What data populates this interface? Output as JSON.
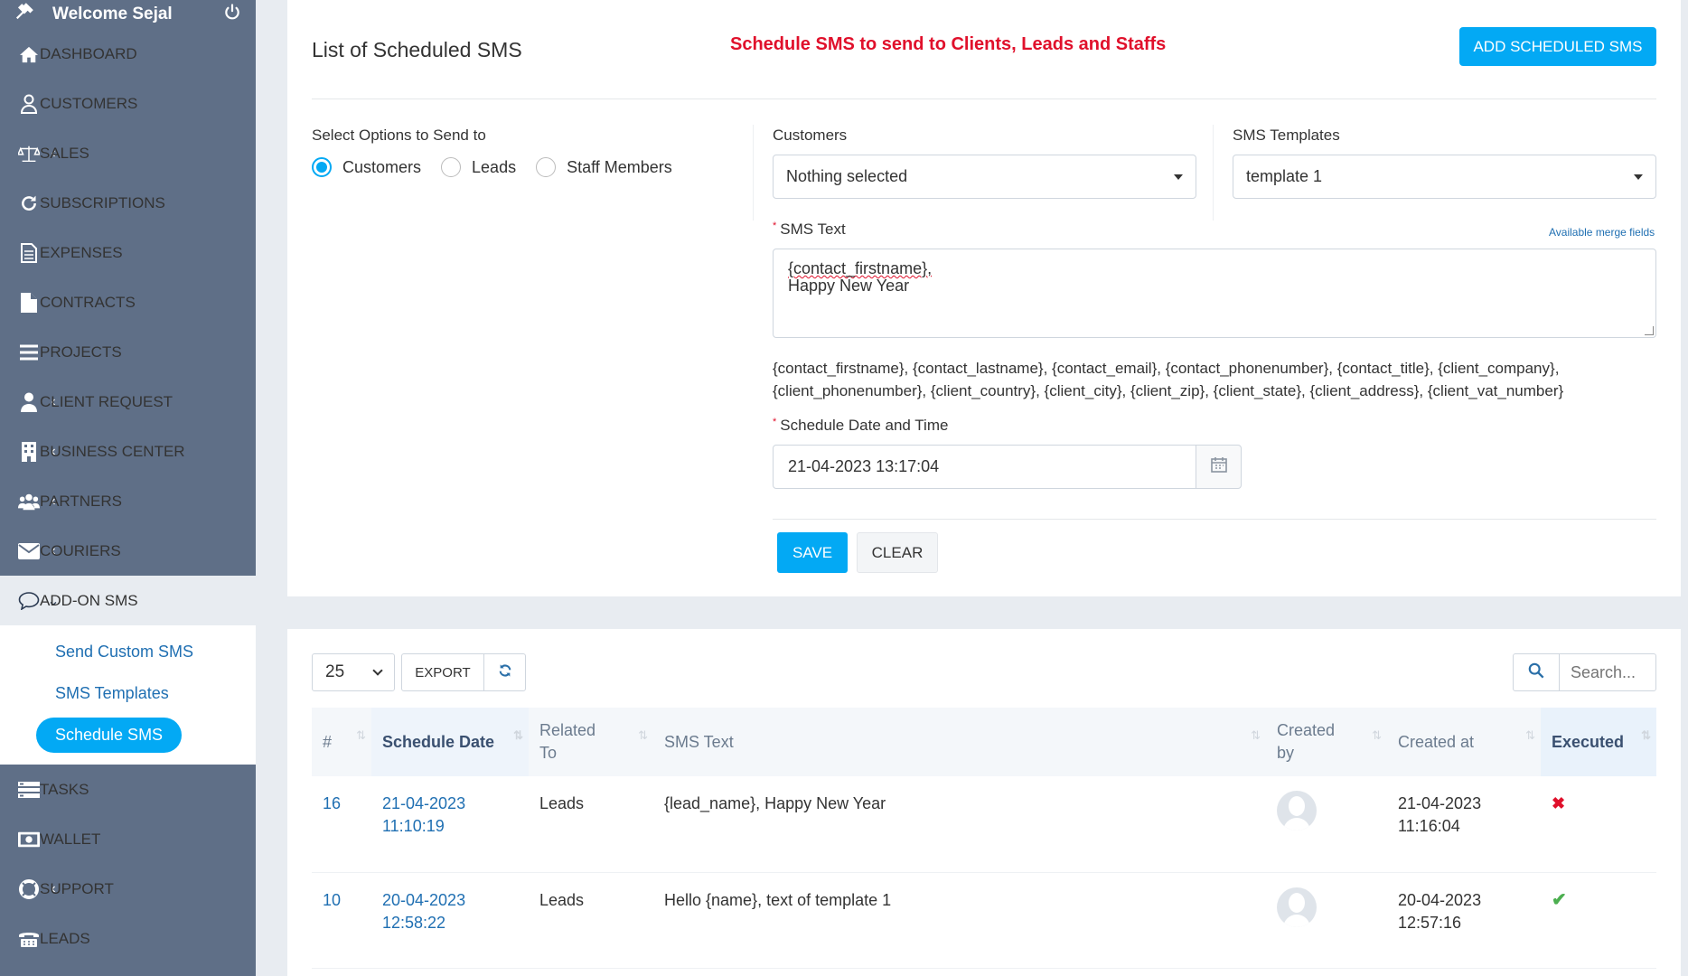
{
  "sidebar": {
    "welcome": "Welcome Sejal",
    "items": [
      {
        "label": "DASHBOARD",
        "icon": "home-icon",
        "chev": ""
      },
      {
        "label": "CUSTOMERS",
        "icon": "user-icon",
        "chev": ""
      },
      {
        "label": "SALES",
        "icon": "balance-scale-icon",
        "chev": "‹"
      },
      {
        "label": "SUBSCRIPTIONS",
        "icon": "refresh-icon",
        "chev": ""
      },
      {
        "label": "EXPENSES",
        "icon": "document-icon",
        "chev": ""
      },
      {
        "label": "CONTRACTS",
        "icon": "file-icon",
        "chev": ""
      },
      {
        "label": "PROJECTS",
        "icon": "bars-icon",
        "chev": ""
      },
      {
        "label": "CLIENT REQUEST",
        "icon": "person-icon",
        "chev": "‹"
      },
      {
        "label": "BUSINESS CENTER",
        "icon": "building-icon",
        "chev": "‹"
      },
      {
        "label": "PARTNERS",
        "icon": "users-icon",
        "chev": "‹"
      },
      {
        "label": "COURIERS",
        "icon": "envelope-icon",
        "chev": "‹"
      },
      {
        "label": "ADD-ON SMS",
        "icon": "chat-icon",
        "chev": "⌄"
      }
    ],
    "sub_items": [
      "Send Custom SMS",
      "SMS Templates",
      "Schedule SMS"
    ],
    "bottom_items": [
      {
        "label": "TASKS",
        "icon": "tasks-icon",
        "chev": ""
      },
      {
        "label": "WALLET",
        "icon": "money-icon",
        "chev": ""
      },
      {
        "label": "SUPPORT",
        "icon": "lifebuoy-icon",
        "chev": "‹"
      },
      {
        "label": "LEADS",
        "icon": "tty-icon",
        "chev": ""
      }
    ]
  },
  "form": {
    "title": "List of Scheduled SMS",
    "promo": "Schedule SMS to send to Clients, Leads and Staffs",
    "add_button": "ADD SCHEDULED SMS",
    "send_to_label": "Select Options to Send to",
    "radio_options": [
      "Customers",
      "Leads",
      "Staff Members"
    ],
    "customers_label": "Customers",
    "customers_value": "Nothing selected",
    "templates_label": "SMS Templates",
    "templates_value": "template 1",
    "sms_text_label": "SMS Text",
    "merge_link": "Available merge fields",
    "sms_text_line1": "{contact_firstname},",
    "sms_text_line2": "Happy New Year",
    "merge_fields_line1": "{contact_firstname}, {contact_lastname}, {contact_email}, {contact_phonenumber}, {contact_title}, {client_company},",
    "merge_fields_line2": "{client_phonenumber}, {client_country}, {client_city}, {client_zip}, {client_state}, {client_address}, {client_vat_number}",
    "schedule_label": "Schedule Date and Time",
    "schedule_value": "21-04-2023 13:17:04",
    "save_label": "SAVE",
    "clear_label": "CLEAR"
  },
  "table": {
    "page_length": "25",
    "export_label": "EXPORT",
    "search_placeholder": "Search...",
    "columns": [
      "#",
      "Schedule Date",
      "Related To",
      "SMS Text",
      "Created by",
      "Created at",
      "Executed"
    ],
    "rows": [
      {
        "id": "16",
        "schedule_date": "21-04-2023",
        "schedule_time": "11:10:19",
        "related_to": "Leads",
        "sms_text": "{lead_name}, Happy New Year",
        "created_date": "21-04-2023",
        "created_time": "11:16:04",
        "executed": "✖"
      },
      {
        "id": "10",
        "schedule_date": "20-04-2023",
        "schedule_time": "12:58:22",
        "related_to": "Leads",
        "sms_text": "Hello {name}, text of template 1",
        "created_date": "20-04-2023",
        "created_time": "12:57:16",
        "executed": "✔"
      }
    ]
  },
  "colors": {
    "accent": "#03a9f4",
    "sidebar": "#5f6f87",
    "promo": "#e0102b",
    "success": "#4caf50"
  }
}
